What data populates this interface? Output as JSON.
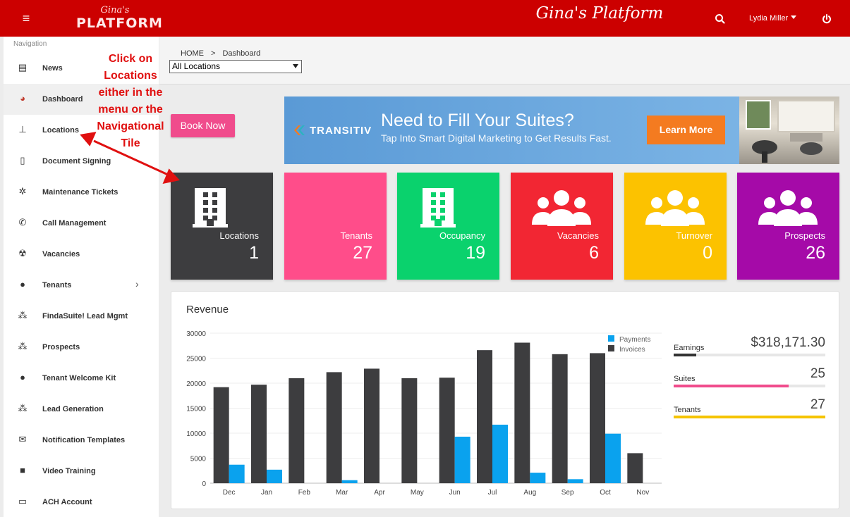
{
  "topbar": {
    "logo_script": "Gina's",
    "logo_word": "PLATFORM",
    "app_title": "Gina's Platform",
    "user_name": "Lydia Miller"
  },
  "sidebar": {
    "heading": "Navigation",
    "items": [
      {
        "label": "News",
        "icon": "newspaper-icon"
      },
      {
        "label": "Dashboard",
        "icon": "gauge-icon"
      },
      {
        "label": "Locations",
        "icon": "pin-icon"
      },
      {
        "label": "Document Signing",
        "icon": "document-icon"
      },
      {
        "label": "Maintenance Tickets",
        "icon": "gears-icon"
      },
      {
        "label": "Call Management",
        "icon": "phone-icon"
      },
      {
        "label": "Vacancies",
        "icon": "radiation-icon"
      },
      {
        "label": "Tenants",
        "icon": "user-icon"
      },
      {
        "label": "FindaSuite! Lead Mgmt",
        "icon": "users-icon"
      },
      {
        "label": "Prospects",
        "icon": "users-icon"
      },
      {
        "label": "Tenant Welcome Kit",
        "icon": "user-icon"
      },
      {
        "label": "Lead Generation",
        "icon": "users-icon"
      },
      {
        "label": "Notification Templates",
        "icon": "mail-bulk-icon"
      },
      {
        "label": "Video Training",
        "icon": "video-icon"
      },
      {
        "label": "ACH Account",
        "icon": "money-icon"
      }
    ]
  },
  "breadcrumb": {
    "home": "HOME",
    "sep": ">",
    "current": "Dashboard"
  },
  "location_select": {
    "value": "All Locations"
  },
  "annotation": {
    "text": "Click on Locations either in the menu or the Navigational Tile",
    "color": "#e01010"
  },
  "book_now": "Book Now",
  "banner": {
    "brand": "TRANSITIV",
    "headline": "Need to Fill Your Suites?",
    "subline": "Tap Into Smart Digital Marketing to Get Results Fast.",
    "cta": "Learn More"
  },
  "tiles": [
    {
      "label": "Locations",
      "value": "1",
      "color": "#3d3d3f",
      "icon": "building-icon"
    },
    {
      "label": "Tenants",
      "value": "27",
      "color": "#ff4d8a",
      "icon": ""
    },
    {
      "label": "Occupancy",
      "value": "19",
      "color": "#0ad26d",
      "icon": "building-icon"
    },
    {
      "label": "Vacancies",
      "value": "6",
      "color": "#f22633",
      "icon": "users-icon"
    },
    {
      "label": "Turnover",
      "value": "0",
      "color": "#fcc200",
      "icon": "users-icon"
    },
    {
      "label": "Prospects",
      "value": "26",
      "color": "#a50aa8",
      "icon": "users-icon"
    }
  ],
  "revenue": {
    "title": "Revenue",
    "stats": [
      {
        "label": "Earnings",
        "value": "$318,171.30",
        "progress": 0.15,
        "color": "#333333"
      },
      {
        "label": "Suites",
        "value": "25",
        "progress": 0.76,
        "color": "#f04c8c"
      },
      {
        "label": "Tenants",
        "value": "27",
        "progress": 1.0,
        "color": "#f5c400"
      }
    ]
  },
  "chart_data": {
    "type": "bar",
    "title": "",
    "xlabel": "",
    "ylabel": "",
    "ylim": [
      0,
      30000
    ],
    "yticks": [
      0,
      5000,
      10000,
      15000,
      20000,
      25000,
      30000
    ],
    "categories": [
      "Dec",
      "Jan",
      "Feb",
      "Mar",
      "Apr",
      "May",
      "Jun",
      "Jul",
      "Aug",
      "Sep",
      "Oct",
      "Nov"
    ],
    "series": [
      {
        "name": "Invoices",
        "color": "#3d3d3f",
        "values": [
          19200,
          19700,
          21000,
          22200,
          22900,
          21000,
          21100,
          26600,
          28100,
          25800,
          26000,
          6000
        ]
      },
      {
        "name": "Payments",
        "color": "#0aa2ee",
        "values": [
          3700,
          2700,
          0,
          600,
          0,
          0,
          9300,
          11700,
          2100,
          800,
          9900,
          0
        ]
      }
    ],
    "legend": "top-right",
    "grid": true
  }
}
